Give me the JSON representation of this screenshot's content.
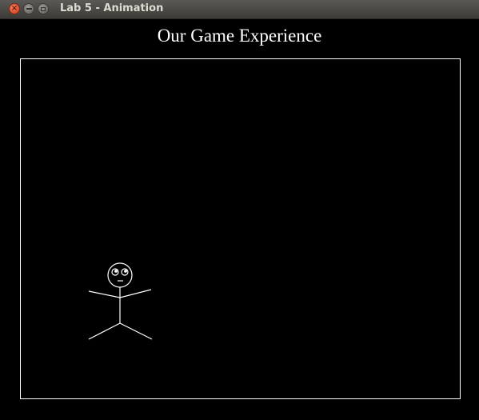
{
  "window": {
    "title": "Lab 5 - Animation",
    "controls": [
      "close-icon",
      "minimize-icon",
      "maximize-icon"
    ]
  },
  "heading": {
    "text": "Our Game Experience"
  },
  "colors": {
    "background": "#000000",
    "foreground": "#ffffff",
    "titlebar": "#3c3b37",
    "close_button": "#e0532f"
  },
  "canvas": {
    "sprite": "stick-figure-icon"
  }
}
